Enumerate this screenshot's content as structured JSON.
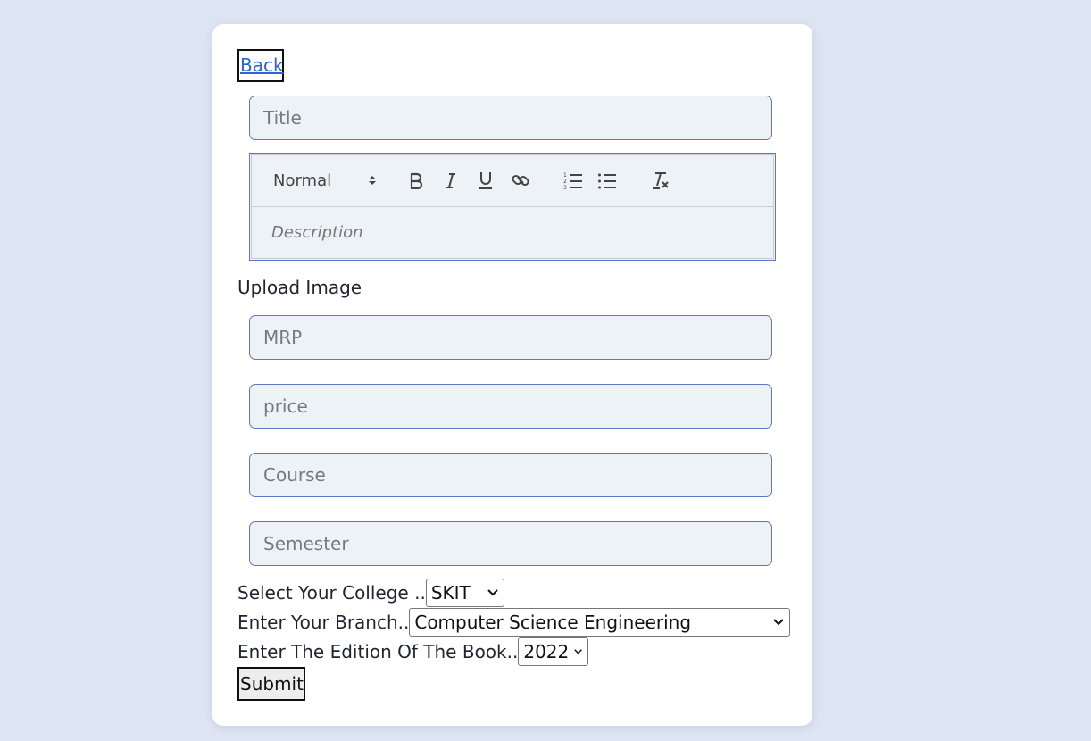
{
  "nav": {
    "back_label": "Back"
  },
  "form": {
    "title_placeholder": "Title",
    "editor": {
      "heading_value": "Normal",
      "description_placeholder": "Description"
    },
    "upload_label": "Upload Image",
    "mrp_placeholder": "MRP",
    "price_placeholder": "price",
    "course_placeholder": "Course",
    "semester_placeholder": "Semester",
    "college": {
      "label": "Select Your College ..",
      "selected": "SKIT"
    },
    "branch": {
      "label": "Enter Your Branch..",
      "selected": "Computer Science Engineering"
    },
    "edition": {
      "label": "Enter The Edition Of The Book..",
      "selected": "2022"
    },
    "submit_label": "Submit"
  },
  "icons": {
    "bold": "bold-icon",
    "italic": "italic-icon",
    "underline": "underline-icon",
    "link": "link-icon",
    "ordered_list": "ordered-list-icon",
    "bullet_list": "bullet-list-icon",
    "clear_format": "clear-format-icon"
  },
  "colors": {
    "page_bg": "#dde4f2",
    "input_border": "#5b78c7",
    "input_bg": "#edf2f6",
    "link": "#2a65d8"
  }
}
